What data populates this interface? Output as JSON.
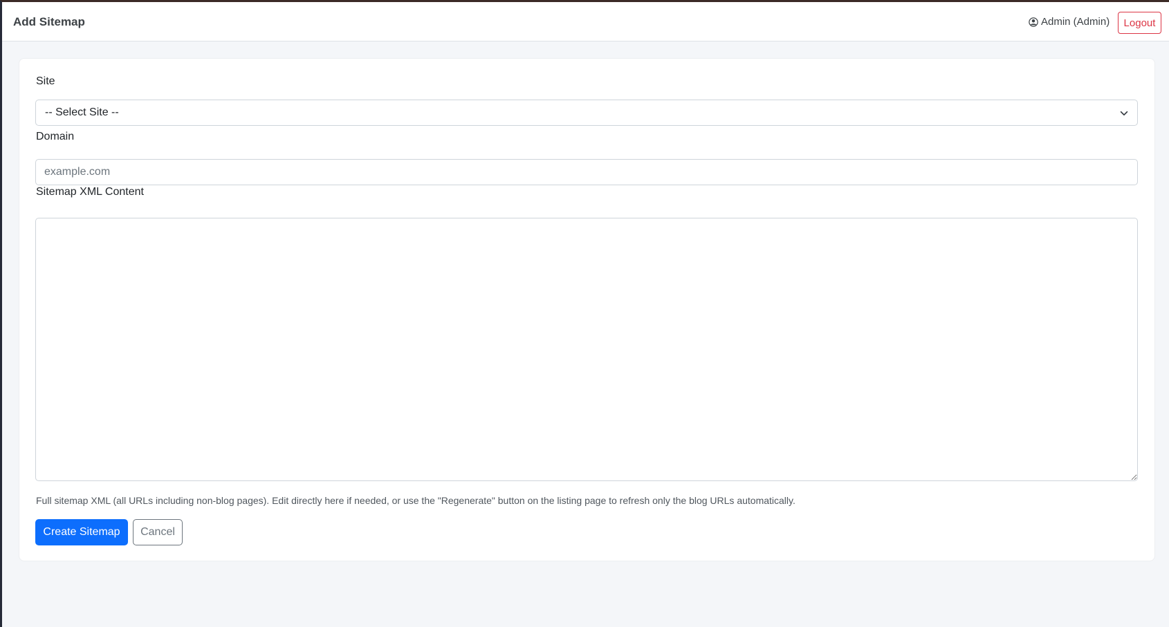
{
  "header": {
    "title": "Add Sitemap",
    "user_label": "Admin (Admin)",
    "logout_label": "Logout"
  },
  "form": {
    "site": {
      "label": "Site",
      "selected": "-- Select Site --"
    },
    "domain": {
      "label": "Domain",
      "value": "",
      "placeholder": "example.com"
    },
    "content": {
      "label": "Sitemap XML Content",
      "value": ""
    },
    "help_text": "Full sitemap XML (all URLs including non-blog pages). Edit directly here if needed, or use the \"Regenerate\" button on the listing page to refresh only the blog URLs automatically.",
    "submit_label": "Create Sitemap",
    "cancel_label": "Cancel"
  },
  "colors": {
    "primary": "#0d6efd",
    "danger": "#dc3545",
    "secondary": "#6c757d"
  },
  "icons": {
    "user": "user-circle-icon",
    "select": "chevron-down-icon"
  }
}
